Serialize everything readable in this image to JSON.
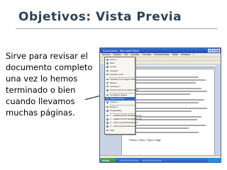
{
  "slide": {
    "title": "Objetivos: Vista Previa",
    "body": "Sirve para revisar el documento completo una vez lo hemos terminado o bien cuando llevamos muchas páginas."
  },
  "screenshot": {
    "window_title": "Documento - Microsoft Word",
    "menu": [
      "Archivo",
      "Edición",
      "Ver",
      "Insertar",
      "Formato",
      "Herramientas",
      "Tabla",
      "Ventana",
      "?"
    ],
    "file_menu_items": [
      {
        "label": "Nuevo...",
        "active": false
      },
      {
        "label": "Abrir...",
        "active": false
      },
      {
        "label": "Cerrar",
        "active": false
      },
      {
        "label": "Guardar",
        "active": false
      },
      {
        "label": "Guardar como...",
        "active": false
      },
      {
        "label": "Guardar como página Web...",
        "active": false
      },
      {
        "label": "Buscar...",
        "active": false
      },
      {
        "label": "Versiones...",
        "active": false
      },
      {
        "label": "Vista previa de la página Web",
        "active": false
      },
      {
        "label": "Configurar página...",
        "active": false
      },
      {
        "label": "Vista preliminar",
        "active": true
      },
      {
        "label": "Imprimir...",
        "active": false
      },
      {
        "label": "Enviar a",
        "active": false
      },
      {
        "label": "Propiedades",
        "active": false
      },
      {
        "label": "1 ...\\EJERCICIOS WORD\\Ej1.doc",
        "active": false
      },
      {
        "label": "2 ...\\EJERCICIOS WORD\\Ej2.doc",
        "active": false
      },
      {
        "label": "3 ...\\Documentos\\Plantilla.doc",
        "active": false
      },
      {
        "label": "4 ...\\Documentos\\Carta.doc",
        "active": false
      },
      {
        "label": "Salir",
        "active": false
      }
    ],
    "doc_note": "Puntos / Tipos / Tipos / Page"
  },
  "colors": {
    "title": "#2c4258",
    "highlight": "#316ac5",
    "taskbar": "#2457c8",
    "start": "#2f8d2a"
  }
}
